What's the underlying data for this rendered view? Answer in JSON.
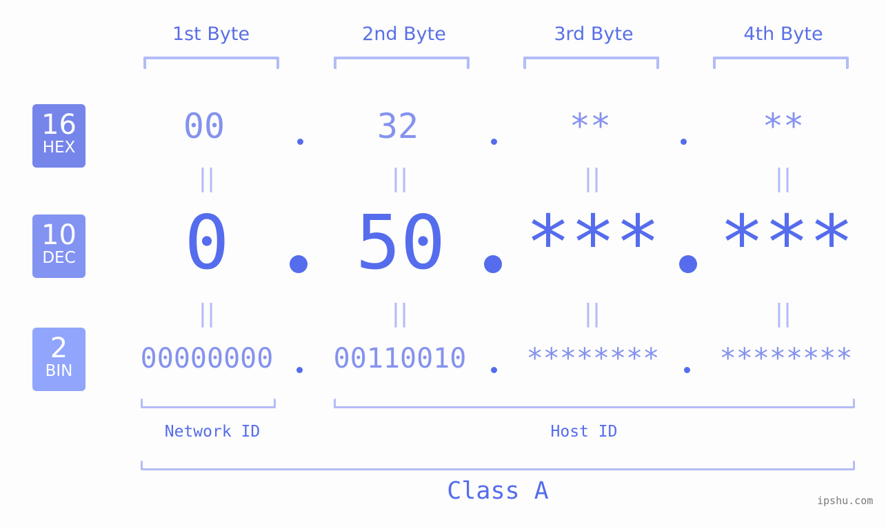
{
  "bytes": [
    {
      "header": "1st Byte",
      "hex": "00",
      "dec": "0",
      "bin": "00000000"
    },
    {
      "header": "2nd Byte",
      "hex": "32",
      "dec": "50",
      "bin": "00110010"
    },
    {
      "header": "3rd Byte",
      "hex": "**",
      "dec": "***",
      "bin": "********"
    },
    {
      "header": "4th Byte",
      "hex": "**",
      "dec": "***",
      "bin": "********"
    }
  ],
  "badges": [
    {
      "number": "16",
      "label": "HEX",
      "color": "#7585ea"
    },
    {
      "number": "10",
      "label": "DEC",
      "color": "#8393f1"
    },
    {
      "number": "2",
      "label": "BIN",
      "color": "#90a5fb"
    }
  ],
  "equals_glyph": "||",
  "segments": {
    "network_id": "Network ID",
    "host_id": "Host ID"
  },
  "class_label": "Class A",
  "watermark": "ipshu.com",
  "colors": {
    "accent": "#556ced",
    "light_accent": "#8592ee",
    "bracket": "#b3bcf7"
  }
}
